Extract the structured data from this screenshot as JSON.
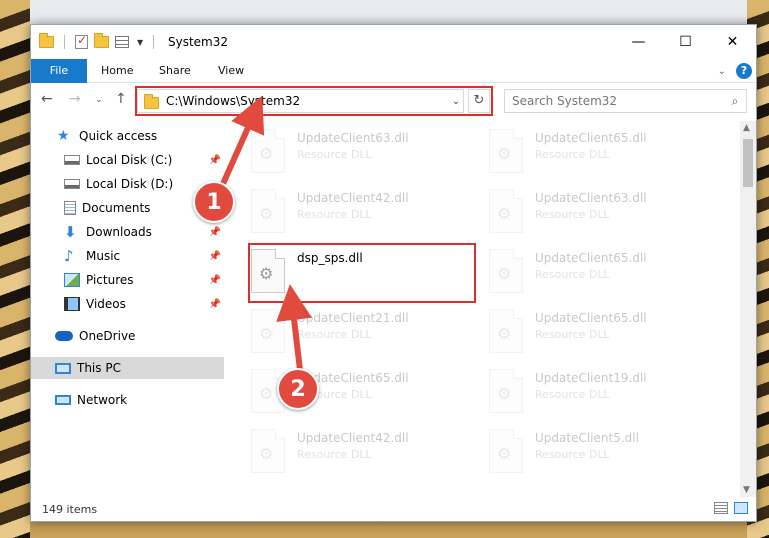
{
  "window": {
    "title": "System32",
    "controls": {
      "minimize": "—",
      "maximize": "☐",
      "close": "✕"
    }
  },
  "ribbon": {
    "tabs": [
      "File",
      "Home",
      "Share",
      "View"
    ]
  },
  "navigation": {
    "address": "C:\\Windows\\System32",
    "search_placeholder": "Search System32"
  },
  "sidebar": {
    "items": [
      {
        "label": "Quick access",
        "icon": "star-icon",
        "pinned": false
      },
      {
        "label": "Local Disk (C:)",
        "icon": "drive-icon",
        "pinned": true
      },
      {
        "label": "Local Disk (D:)",
        "icon": "drive-icon",
        "pinned": false
      },
      {
        "label": "Documents",
        "icon": "documents-icon",
        "pinned": true
      },
      {
        "label": "Downloads",
        "icon": "downloads-icon",
        "pinned": true
      },
      {
        "label": "Music",
        "icon": "music-icon",
        "pinned": true
      },
      {
        "label": "Pictures",
        "icon": "pictures-icon",
        "pinned": true
      },
      {
        "label": "Videos",
        "icon": "videos-icon",
        "pinned": true
      },
      {
        "label": "OneDrive",
        "icon": "onedrive-icon",
        "pinned": false
      },
      {
        "label": "This PC",
        "icon": "this-pc-icon",
        "pinned": false,
        "selected": true
      },
      {
        "label": "Network",
        "icon": "network-icon",
        "pinned": false
      }
    ]
  },
  "files": [
    {
      "name": "UpdateClient63.dll",
      "type": "Resource DLL",
      "faded": true
    },
    {
      "name": "UpdateClient65.dll",
      "type": "Resource DLL",
      "faded": true
    },
    {
      "name": "UpdateClient42.dll",
      "type": "Resource DLL",
      "faded": true
    },
    {
      "name": "UpdateClient63.dll",
      "type": "Resource DLL",
      "faded": true
    },
    {
      "name": "dsp_sps.dll",
      "type": "",
      "faded": false
    },
    {
      "name": "UpdateClient65.dll",
      "type": "Resource DLL",
      "faded": true
    },
    {
      "name": "UpdateClient21.dll",
      "type": "Resource DLL",
      "faded": true
    },
    {
      "name": "UpdateClient65.dll",
      "type": "Resource DLL",
      "faded": true
    },
    {
      "name": "UpdateClient65.dll",
      "type": "Resource DLL",
      "faded": true
    },
    {
      "name": "UpdateClient19.dll",
      "type": "Resource DLL",
      "faded": true
    },
    {
      "name": "UpdateClient42.dll",
      "type": "Resource DLL",
      "faded": true
    },
    {
      "name": "UpdateClient5.dll",
      "type": "Resource DLL",
      "faded": true
    }
  ],
  "status": {
    "item_count": "149 items"
  },
  "annotations": {
    "marker_1": "1",
    "marker_2": "2",
    "color": "#d9302c"
  },
  "colors": {
    "accent": "#1979ca",
    "highlight": "#d9302c",
    "selected_bg": "#d9d9d9"
  }
}
